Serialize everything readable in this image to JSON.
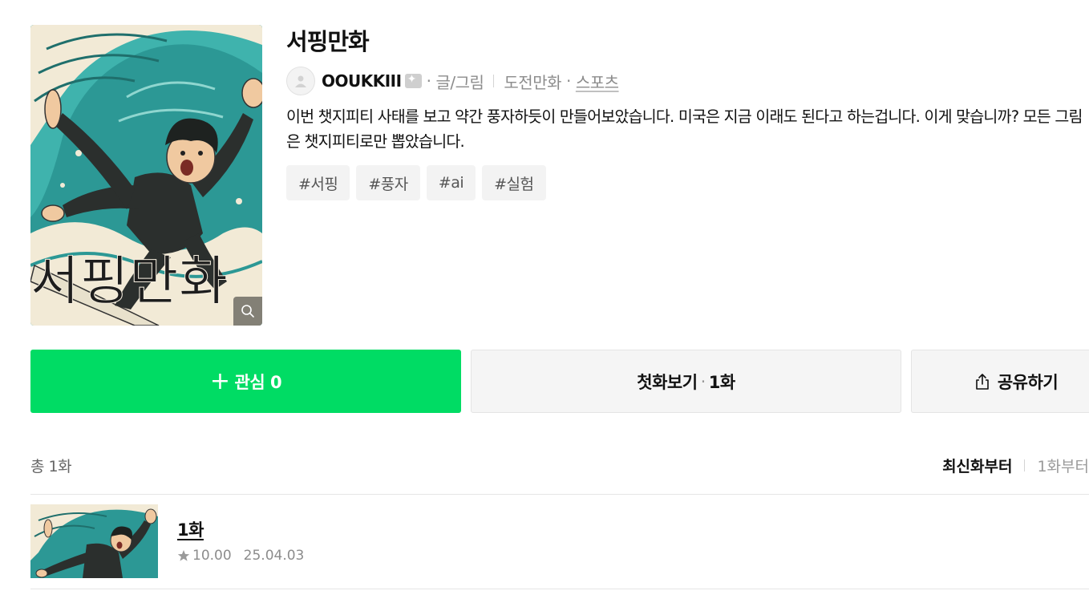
{
  "series": {
    "title": "서핑만화",
    "cover_title": "서핑만화",
    "author": "OOUKKIII",
    "author_role": "글/그림",
    "category": "도전만화",
    "genre": "스포츠",
    "description": "이번 챗지피티 사태를 보고 약간 풍자하듯이 만들어보았습니다. 미국은 지금 이래도 된다고 하는겁니다. 이게 맞습니까? 모든 그림은 챗지피티로만 뽑았습니다.",
    "tags": [
      "#서핑",
      "#풍자",
      "#ai",
      "#실험"
    ]
  },
  "actions": {
    "favorite_label": "관심 0",
    "first_label": "첫화보기",
    "first_episode": "1화",
    "share_label": "공유하기"
  },
  "list": {
    "total": "총 1화",
    "sort_latest": "최신화부터",
    "sort_first": "1화부터",
    "episodes": [
      {
        "title": "1화",
        "rating": "10.00",
        "date": "25.04.03"
      }
    ]
  },
  "colors": {
    "accent_green": "#00dc64",
    "button_gray": "#f5f5f5",
    "muted_text": "#8c8c8c"
  },
  "icons": [
    "search-icon",
    "user-icon",
    "author-badge-icon",
    "plus-icon",
    "share-icon",
    "star-icon"
  ]
}
